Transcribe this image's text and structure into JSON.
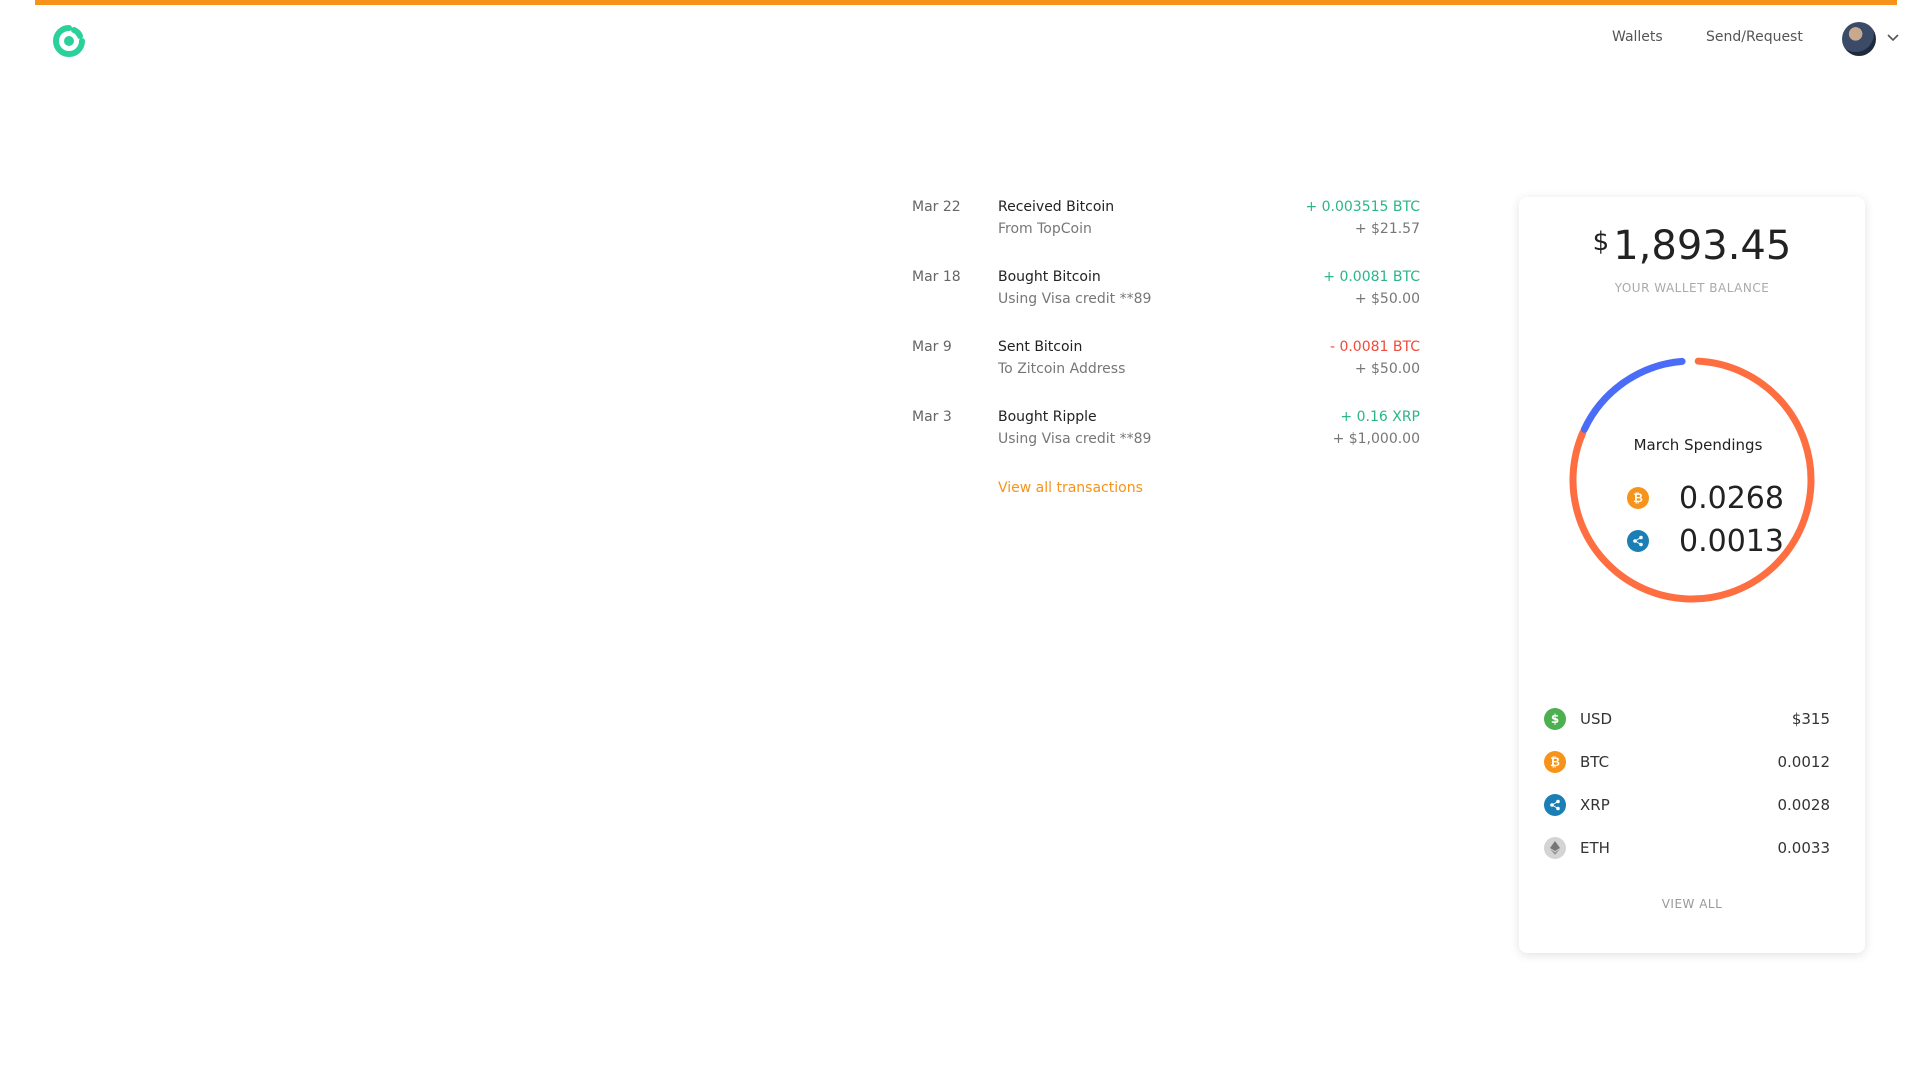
{
  "colors": {
    "accent": "#f7931a",
    "brand": "#2ad19a",
    "positive": "#2ab58a",
    "negative": "#f04a3a",
    "btc": "#f7931a",
    "xrp": "#1b7fb5",
    "usd": "#4caf50",
    "eth": "#d4d4d4",
    "donut_blue": "#4a6cf7",
    "donut_orange": "#ff6e40"
  },
  "header": {
    "logo_icon": "brand-logo-icon",
    "nav": [
      {
        "label": "Wallets"
      },
      {
        "label": "Send/Request"
      }
    ],
    "avatar_icon": "user-avatar",
    "menu_icon": "chevron-down-icon"
  },
  "transactions": [
    {
      "date": "Mar 22",
      "title": "Received Bitcoin",
      "subtitle": "From TopCoin",
      "amount": "+ 0.003515 BTC",
      "fiat": "+ $21.57",
      "direction": "positive"
    },
    {
      "date": "Mar 18",
      "title": "Bought Bitcoin",
      "subtitle": "Using Visa credit **89",
      "amount": "+ 0.0081 BTC",
      "fiat": "+ $50.00",
      "direction": "positive"
    },
    {
      "date": "Mar 9",
      "title": "Sent Bitcoin",
      "subtitle": "To Zitcoin Address",
      "amount": "- 0.0081 BTC",
      "fiat": "+ $50.00",
      "direction": "negative"
    },
    {
      "date": "Mar 3",
      "title": "Bought Ripple",
      "subtitle": "Using Visa credit **89",
      "amount": "+ 0.16 XRP",
      "fiat": "+ $1,000.00",
      "direction": "positive"
    }
  ],
  "view_all_transactions": "View all transactions",
  "wallet": {
    "currency_symbol": "$",
    "balance": "1,893.45",
    "balance_label": "YOUR WALLET BALANCE",
    "spendings": {
      "title": "March Spendings",
      "progress_fraction": 0.18,
      "rows": [
        {
          "icon": "bitcoin-icon",
          "value": "0.0268"
        },
        {
          "icon": "ripple-icon",
          "value": "0.0013"
        }
      ]
    },
    "assets": [
      {
        "icon": "dollar-icon",
        "name": "USD",
        "value": "$315"
      },
      {
        "icon": "bitcoin-icon",
        "name": "BTC",
        "value": "0.0012"
      },
      {
        "icon": "ripple-icon",
        "name": "XRP",
        "value": "0.0028"
      },
      {
        "icon": "ethereum-icon",
        "name": "ETH",
        "value": "0.0033"
      }
    ],
    "view_all": "VIEW ALL"
  }
}
